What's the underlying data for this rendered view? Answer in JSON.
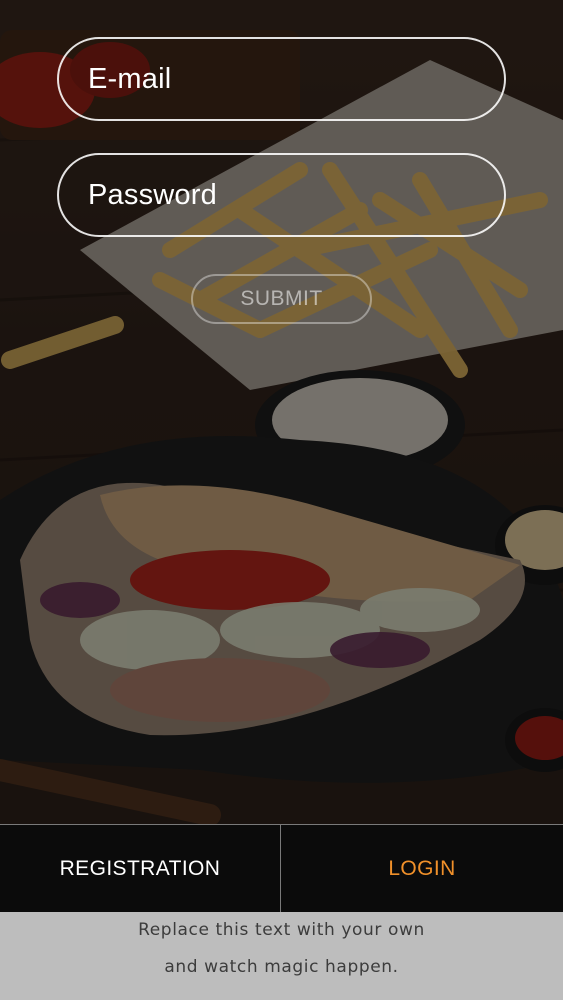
{
  "form": {
    "email_placeholder": "E-mail",
    "password_placeholder": "Password",
    "submit_label": "SUBMIT"
  },
  "tabs": {
    "registration_label": "REGISTRATION",
    "login_label": "LOGIN"
  },
  "footer": {
    "line1": "Replace this text with your own",
    "line2": "and watch magic happen."
  },
  "colors": {
    "active_tab": "#f0902a",
    "tabbar_bg": "#0b0b0b",
    "footer_bg": "#bdbdbd"
  }
}
